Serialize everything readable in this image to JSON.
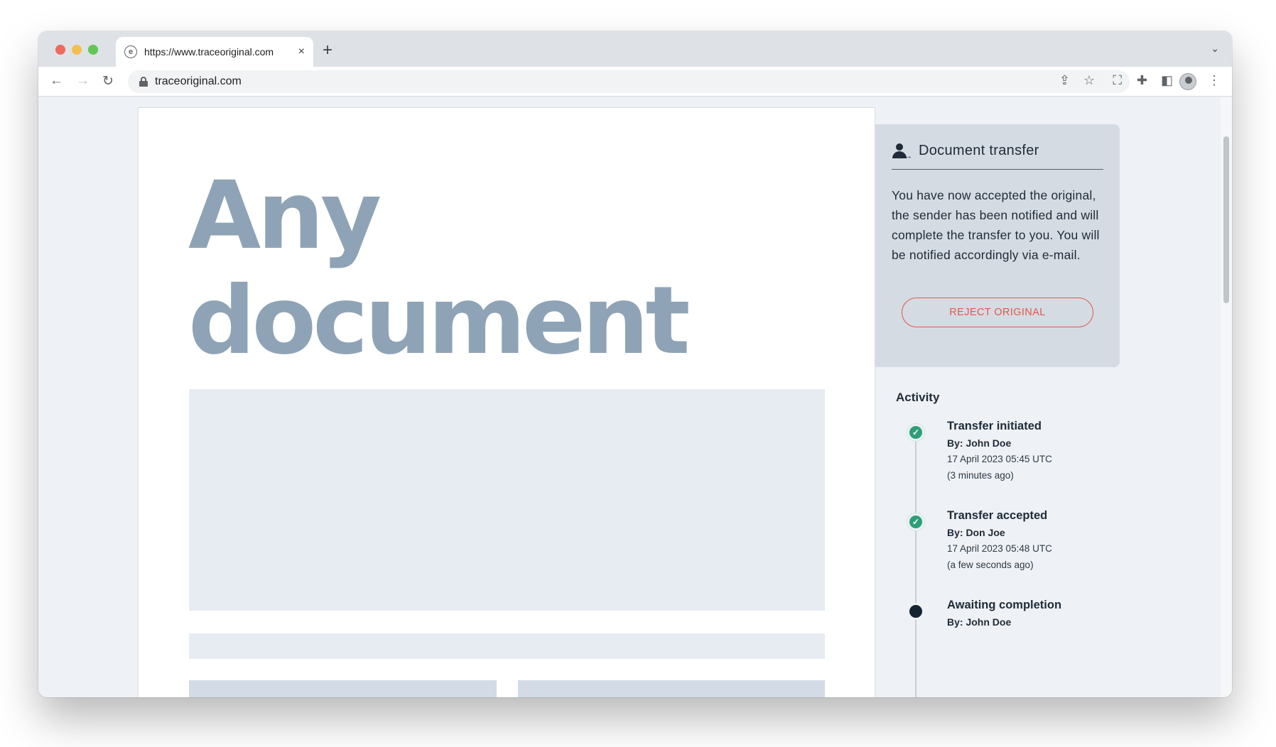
{
  "browser": {
    "tab_title": "https://www.traceoriginal.com",
    "tab_close": "×",
    "new_tab": "+",
    "url": "traceoriginal.com"
  },
  "document": {
    "heading_line1": "Any",
    "heading_line2": "document"
  },
  "transfer_panel": {
    "title": "Document transfer",
    "message": "You have now accepted the original, the sender has been notified and will complete the transfer to you. You will be notified accordingly via e-mail.",
    "reject_label": "REJECT ORIGINAL"
  },
  "activity": {
    "title": "Activity",
    "items": [
      {
        "name": "Transfer initiated",
        "by": "By: John Doe",
        "date": "17 April 2023 05:45 UTC",
        "relative": "(3 minutes ago)",
        "status": "done"
      },
      {
        "name": "Transfer accepted",
        "by": "By: Don Joe",
        "date": "17 April 2023 05:48 UTC",
        "relative": "(a few seconds ago)",
        "status": "done"
      },
      {
        "name": "Awaiting completion",
        "by": "By: John Doe",
        "status": "pending"
      }
    ]
  },
  "colors": {
    "accent_reject": "#e0584f",
    "done_green": "#2e9e78",
    "pending_dark": "#142232",
    "heading_slate": "#8ea3b6"
  }
}
